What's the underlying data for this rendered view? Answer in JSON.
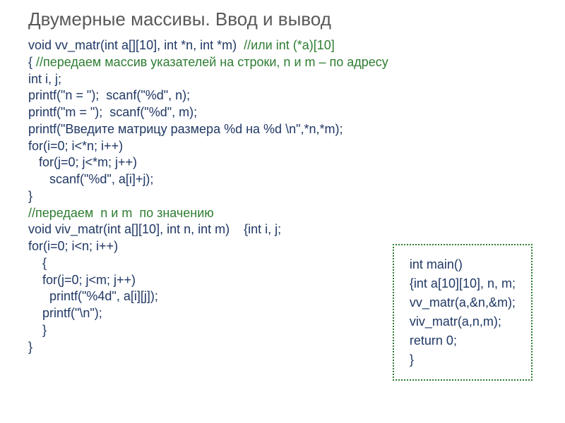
{
  "title": "Двумерные массивы. Ввод и вывод",
  "code": {
    "l1a": "void vv_matr(int a[][10], int *n, int *m)  ",
    "l1b": "//или int (*a)[10]",
    "l2a": "{ ",
    "l2b": "//передаем массив указателей на строки, n и m – по адресу",
    "l3": "int i, j;",
    "l4": "printf(\"n = \");  scanf(\"%d\", n);",
    "l5": "printf(\"m = \");  scanf(\"%d\", m);",
    "l6": "printf(\"Введите матрицу размера %d на %d \\n\",*n,*m);",
    "l7": "for(i=0; i<*n; i++)",
    "l8": "   for(j=0; j<*m; j++)",
    "l9": "      scanf(\"%d\", a[i]+j);",
    "l10": "}",
    "l11": "//передаем  n и m  по значению",
    "l12": "void viv_matr(int a[][10], int n, int m)    {int i, j;",
    "l13": "for(i=0; i<n; i++)",
    "l14": "    {",
    "l15": "    for(j=0; j<m; j++)",
    "l16": "      printf(\"%4d\", a[i][j]);",
    "l17": "    printf(\"\\n\");",
    "l18": "    }",
    "l19": "}"
  },
  "main": {
    "m1": "int main()",
    "m2": "{int a[10][10], n, m;",
    "m3": "vv_matr(a,&n,&m);",
    "m4": "viv_matr(a,n,m);",
    "m5": "return 0;",
    "m6": "}"
  }
}
